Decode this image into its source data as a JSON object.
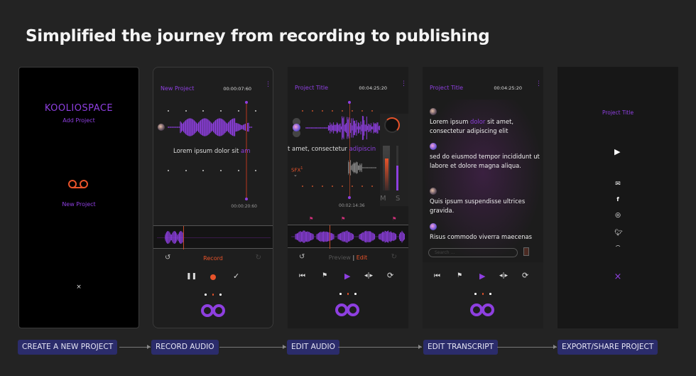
{
  "heading": "Simplified the journey from recording to publishing",
  "colors": {
    "accent": "#8e3fe0",
    "record": "#e8532a",
    "step_label_bg": "#2b2c6b"
  },
  "screen1": {
    "brand": "KOOLIOSPACE",
    "add_project": "Add Project",
    "new_project": "New Project",
    "icon": "voicemail-icon",
    "close": "×"
  },
  "screen2": {
    "title": "New Project",
    "time": "00:00:07:60",
    "caption_plain": "Lorem ipsum dolor sit ",
    "caption_highlight": "am",
    "bottom_time": "00:00:20:60",
    "mode": "Record",
    "pagination_active": 2
  },
  "screen3": {
    "title": "Project Title",
    "time": "00:04:25:20",
    "caption_plain": "t amet, consectetur ",
    "caption_highlight": "adipiscin",
    "sfx": "SFX",
    "sfx_count": "1",
    "bottom_time": "00:02:14:36",
    "mute": "M",
    "solo": "S",
    "preview": "Preview",
    "edit": "Edit",
    "pagination_active": 2
  },
  "screen4": {
    "title": "Project Title",
    "time": "00:04:25:20",
    "transcript": [
      {
        "before": "Lorem ipsum ",
        "highlight": "dolor",
        "after": " sit amet, consectetur adipiscing elit"
      },
      {
        "before": "sed do eiusmod tempor incididunt ut labore et dolore magna aliqua.",
        "highlight": "",
        "after": ""
      },
      {
        "before": "Quis ipsum suspendisse ultrices gravida.",
        "highlight": "",
        "after": ""
      },
      {
        "before": "Risus commodo viverra maecenas",
        "highlight": "",
        "after": ""
      }
    ],
    "search_placeholder": "Search ..."
  },
  "screen5": {
    "title": "Project Title",
    "share_icons": [
      "mail-icon",
      "facebook-icon",
      "whatsapp-icon",
      "twitter-icon"
    ],
    "close": "×"
  },
  "steps": [
    "CREATE A NEW PROJECT",
    "RECORD AUDIO",
    "EDIT AUDIO",
    "EDIT TRANSCRIPT",
    "EXPORT/SHARE PROJECT"
  ]
}
